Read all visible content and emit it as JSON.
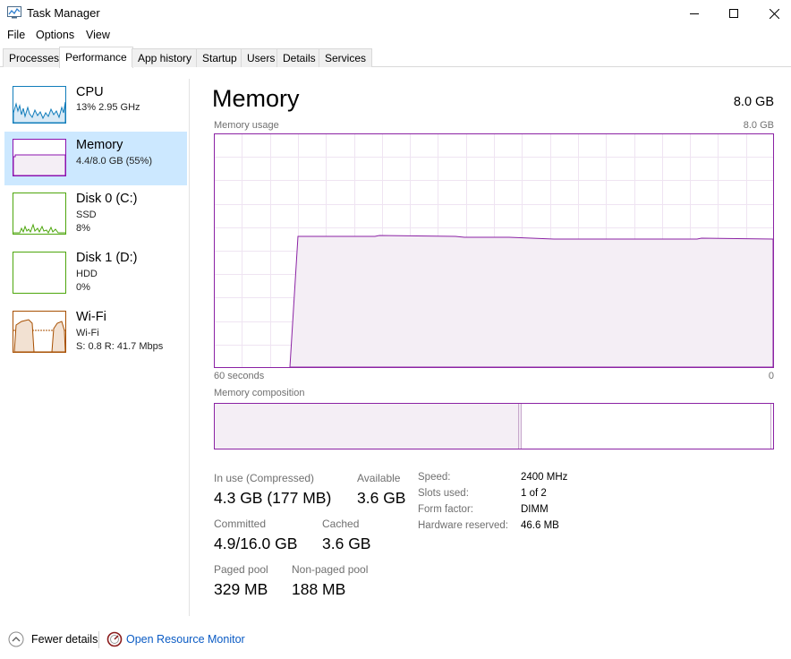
{
  "window": {
    "title": "Task Manager",
    "icons": {
      "app": "task-manager-icon",
      "minimize": "minimize-icon",
      "maximize": "maximize-icon",
      "close": "close-icon"
    }
  },
  "menu": [
    "File",
    "Options",
    "View"
  ],
  "tabs": [
    {
      "label": "Processes",
      "active": false
    },
    {
      "label": "Performance",
      "active": true
    },
    {
      "label": "App history",
      "active": false
    },
    {
      "label": "Startup",
      "active": false
    },
    {
      "label": "Users",
      "active": false
    },
    {
      "label": "Details",
      "active": false
    },
    {
      "label": "Services",
      "active": false
    }
  ],
  "sidebar": {
    "items": [
      {
        "title": "CPU",
        "line1": "13%  2.95 GHz",
        "line2": "",
        "color": "#117dbb",
        "selected": false
      },
      {
        "title": "Memory",
        "line1": "4.4/8.0 GB (55%)",
        "line2": "",
        "color": "#8b12ae",
        "selected": true
      },
      {
        "title": "Disk 0 (C:)",
        "line1": "SSD",
        "line2": "8%",
        "color": "#4da60c",
        "selected": false
      },
      {
        "title": "Disk 1 (D:)",
        "line1": "HDD",
        "line2": "0%",
        "color": "#4da60c",
        "selected": false
      },
      {
        "title": "Wi-Fi",
        "line1": "Wi-Fi",
        "line2": "S: 0.8  R: 41.7 Mbps",
        "color": "#a74f01",
        "selected": false
      }
    ]
  },
  "main": {
    "title": "Memory",
    "capacity": "8.0 GB",
    "usage_label": "Memory usage",
    "usage_max": "8.0 GB",
    "axis_left": "60 seconds",
    "axis_right": "0",
    "composition_label": "Memory composition",
    "accent": "#8b22a4",
    "stats": {
      "in_use_label": "In use (Compressed)",
      "in_use_value": "4.3 GB (177 MB)",
      "available_label": "Available",
      "available_value": "3.6 GB",
      "committed_label": "Committed",
      "committed_value": "4.9/16.0 GB",
      "cached_label": "Cached",
      "cached_value": "3.6 GB",
      "paged_label": "Paged pool",
      "paged_value": "329 MB",
      "nonpaged_label": "Non-paged pool",
      "nonpaged_value": "188 MB"
    },
    "specs": [
      {
        "label": "Speed:",
        "value": "2400 MHz"
      },
      {
        "label": "Slots used:",
        "value": "1 of 2"
      },
      {
        "label": "Form factor:",
        "value": "DIMM"
      },
      {
        "label": "Hardware reserved:",
        "value": "46.6 MB"
      }
    ]
  },
  "footer": {
    "fewer_details": "Fewer details",
    "open_resource_monitor": "Open Resource Monitor",
    "link_color": "#0a5bc4"
  }
}
